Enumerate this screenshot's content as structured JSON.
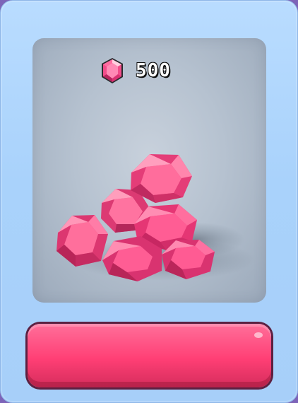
{
  "store_item": {
    "currency_icon": "pink-gem-icon",
    "price": "500",
    "colors": {
      "panel": "#b7c2d0",
      "gem": "#ff4f8f",
      "button": "#ff4f80"
    }
  },
  "purchase_button": {
    "label": ""
  }
}
